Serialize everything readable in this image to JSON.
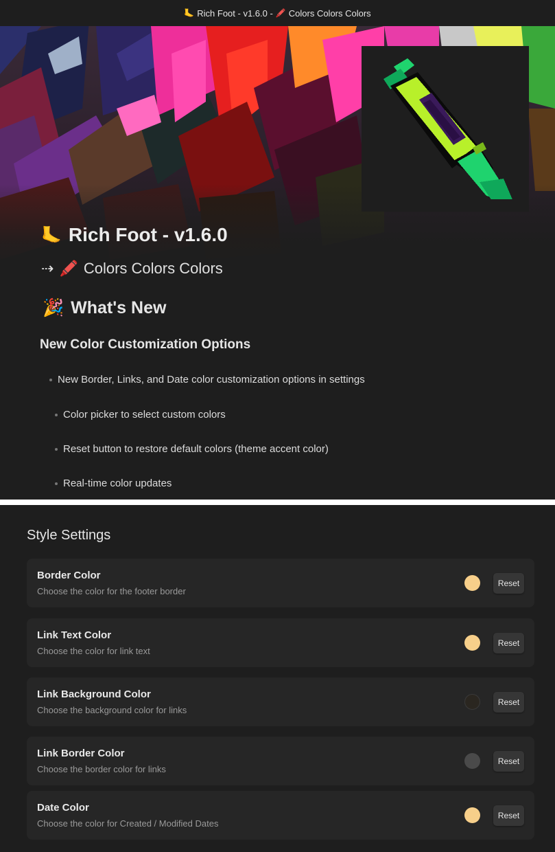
{
  "window": {
    "title_prefix_icon": "foot-emoji",
    "title_left": "Rich Foot - v1.6.0 -",
    "title_mid_icon": "crayon-emoji",
    "title_right": "Colors Colors Colors"
  },
  "release": {
    "heading": "Rich Foot - v1.6.0",
    "heading_icon": "foot-emoji",
    "subheading_arrow": "⇢",
    "subheading_icon": "crayon-emoji",
    "subheading": "Colors Colors Colors",
    "whats_new_icon": "party-popper-emoji",
    "whats_new": "What's New",
    "section_title": "New Color Customization Options",
    "bullets": [
      "New Border, Links, and Date color customization options in settings",
      "Color picker to select custom colors",
      "Reset button to restore default colors (theme accent color)",
      "Real-time color updates"
    ]
  },
  "settings": {
    "title": "Style Settings",
    "items": [
      {
        "name": "Border Color",
        "desc": "Choose the color for the footer border",
        "color": "#f7cf8a",
        "reset": "Reset"
      },
      {
        "name": "Link Text Color",
        "desc": "Choose the color for link text",
        "color": "#f7cf8a",
        "reset": "Reset"
      },
      {
        "name": "Link Background Color",
        "desc": "Choose the background color for links",
        "color": "#2a2620",
        "reset": "Reset"
      },
      {
        "name": "Link Border Color",
        "desc": "Choose the border color for links",
        "color": "#4a4a4a",
        "reset": "Reset"
      },
      {
        "name": "Date Color",
        "desc": "Choose the color for Created / Modified Dates",
        "color": "#f7cf8a",
        "reset": "Reset"
      }
    ]
  },
  "colors": {
    "background": "#1e1e1e",
    "card": "#262626",
    "crayon_body": "#b8f02a",
    "crayon_tip": "#1fd36e",
    "crayon_window": "#3a1a5a"
  }
}
